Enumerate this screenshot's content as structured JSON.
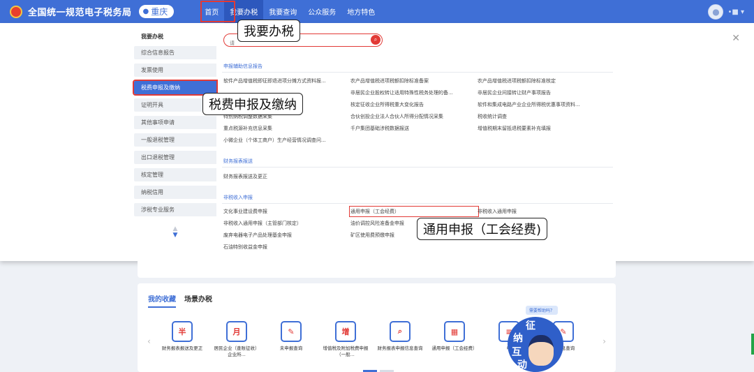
{
  "header": {
    "site_title": "全国统一规范电子税务局",
    "region": "重庆",
    "nav": [
      "首页",
      "我要办税",
      "我要查询",
      "公众服务",
      "地方特色"
    ],
    "active_nav_index": 1,
    "user_name": "•■ ▾"
  },
  "sidebar": {
    "title": "我要办税",
    "items": [
      "综合信息报告",
      "发票使用",
      "税费申报及缴纳",
      "证明开具",
      "其他事项申请",
      "一般退税管理",
      "出口退税管理",
      "核定管理",
      "纳税信用",
      "涉税专业服务"
    ],
    "active_index": 2
  },
  "search": {
    "placeholder": "请"
  },
  "sections": [
    {
      "title": "申报辅助信息报告",
      "items": [
        "软件产品增值税即征即退进项分摊方式资料报...",
        "农产品增值税进项税额扣除标准备案",
        "农产品增值税进项税额扣除标准核定",
        "",
        "非居民企业股权转让适用特殊性税务处理的备...",
        "非居民企业间接转让财产事项报告",
        "",
        "核定征收企业所得税重大变化报告",
        "软件和集成电路产业企业所得税优惠事项资料...",
        "特别纳税调整数据采集",
        "合伙创投企业法人合伙人所得分配情况采集",
        "税收统计调查",
        "重点税源补充信息采集",
        "千户集团基础涉税数据报送",
        "增值税期末留抵退税要素补充填报",
        "小微企业（个体工商户）生产经营情况调查问...",
        "",
        ""
      ]
    },
    {
      "title": "财务报表报送",
      "items": [
        "财务报表报送及更正"
      ]
    },
    {
      "title": "非税收入申报",
      "items": [
        "文化事业建设费申报",
        "通用申报（工会经费）",
        "非税收入通用申报",
        "非税收入通用申报（主管部门核定）",
        "油价调控风险准备金申报",
        "",
        "废弃电器电子产品处理基金申报",
        "矿区使用费预缴申报",
        "",
        "石油特别收益金申报",
        "",
        ""
      ]
    }
  ],
  "callouts": {
    "nav": "我要办税",
    "sidebar": "税费申报及缴纳",
    "item": "通用申报（工会经费)"
  },
  "favorites": {
    "tabs": [
      "我的收藏",
      "场景办税"
    ],
    "help": "需要帮助吗？",
    "assistant_text": [
      "征",
      "纳",
      "互",
      "动"
    ],
    "items": [
      {
        "label": "财务报表报送及更正",
        "icon": "半"
      },
      {
        "label": "居民企业（查账征收）企业所...",
        "icon": "月"
      },
      {
        "label": "未申报查询",
        "icon": "✎"
      },
      {
        "label": "增值税及附加税费申报（一般...",
        "icon": "增"
      },
      {
        "label": "财务报表申报信息查询",
        "icon": "⌕"
      },
      {
        "label": "通用申报（工会经费）",
        "icon": "▦"
      },
      {
        "label": "申",
        "icon": "≡"
      },
      {
        "label": "报信息查询",
        "icon": "✎"
      }
    ]
  },
  "colors": {
    "primary": "#3f6fd6",
    "highlight": "#e23a36"
  }
}
